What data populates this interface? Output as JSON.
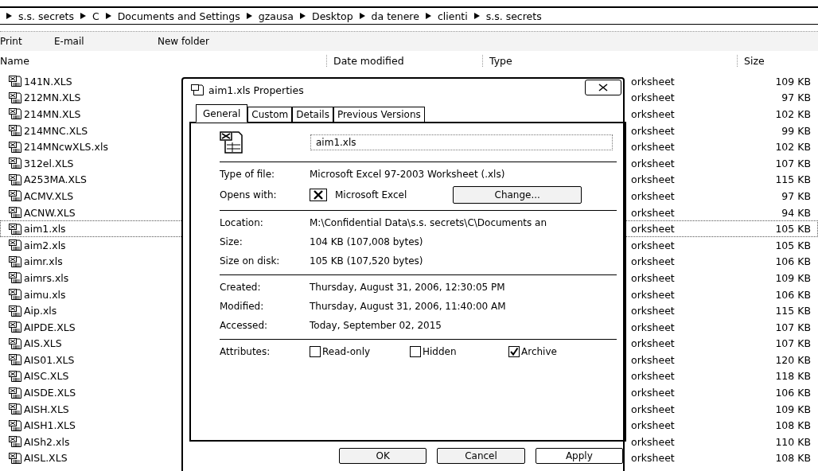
{
  "breadcrumb": [
    "s.s. secrets",
    "C",
    "Documents and Settings",
    "gzausa",
    "Desktop",
    "da tenere",
    "clienti",
    "s.s. secrets"
  ],
  "toolbar": [
    "Print",
    "E-mail",
    "New folder"
  ],
  "columns": [
    "Name",
    "Date modified",
    "Type",
    "Size"
  ],
  "files": [
    {
      "name": "141N.XLS",
      "type": "orksheet",
      "size": "109 KB",
      "selected": false
    },
    {
      "name": "212MN.XLS",
      "type": "orksheet",
      "size": "97 KB",
      "selected": false
    },
    {
      "name": "214MN.XLS",
      "type": "orksheet",
      "size": "102 KB",
      "selected": false
    },
    {
      "name": "214MNC.XLS",
      "type": "orksheet",
      "size": "99 KB",
      "selected": false
    },
    {
      "name": "214MNcwXLS.xls",
      "type": "orksheet",
      "size": "102 KB",
      "selected": false
    },
    {
      "name": "312el.XLS",
      "type": "orksheet",
      "size": "107 KB",
      "selected": false
    },
    {
      "name": "A253MA.XLS",
      "type": "orksheet",
      "size": "115 KB",
      "selected": false
    },
    {
      "name": "ACMV.XLS",
      "type": "orksheet",
      "size": "97 KB",
      "selected": false
    },
    {
      "name": "ACNW.XLS",
      "type": "orksheet",
      "size": "94 KB",
      "selected": false
    },
    {
      "name": "aim1.xls",
      "type": "orksheet",
      "size": "105 KB",
      "selected": true
    },
    {
      "name": "aim2.xls",
      "type": "orksheet",
      "size": "105 KB",
      "selected": false
    },
    {
      "name": "aimr.xls",
      "type": "orksheet",
      "size": "106 KB",
      "selected": false
    },
    {
      "name": "aimrs.xls",
      "type": "orksheet",
      "size": "109 KB",
      "selected": false
    },
    {
      "name": "aimu.xls",
      "type": "orksheet",
      "size": "106 KB",
      "selected": false
    },
    {
      "name": "Aip.xls",
      "type": "orksheet",
      "size": "115 KB",
      "selected": false
    },
    {
      "name": "AIPDE.XLS",
      "type": "orksheet",
      "size": "107 KB",
      "selected": false
    },
    {
      "name": "AIS.XLS",
      "type": "orksheet",
      "size": "107 KB",
      "selected": false
    },
    {
      "name": "AIS01.XLS",
      "type": "orksheet",
      "size": "120 KB",
      "selected": false
    },
    {
      "name": "AISC.XLS",
      "type": "orksheet",
      "size": "118 KB",
      "selected": false
    },
    {
      "name": "AISDE.XLS",
      "type": "orksheet",
      "size": "106 KB",
      "selected": false
    },
    {
      "name": "AISH.XLS",
      "type": "orksheet",
      "size": "109 KB",
      "selected": false
    },
    {
      "name": "AISH1.XLS",
      "type": "orksheet",
      "size": "108 KB",
      "selected": false
    },
    {
      "name": "AISh2.xls",
      "type": "orksheet",
      "size": "110 KB",
      "selected": false
    },
    {
      "name": "AISL.XLS",
      "type": "orksheet",
      "size": "108 KB",
      "selected": false
    }
  ],
  "dialog": {
    "title": "aim1.xls Properties",
    "tabs": [
      {
        "label": "General",
        "selected": true
      },
      {
        "label": "Custom",
        "selected": false
      },
      {
        "label": "Details",
        "selected": false
      },
      {
        "label": "Previous Versions",
        "selected": false
      }
    ],
    "file_name": "aim1.xls",
    "type_of_file": {
      "label": "Type of file:",
      "value": "Microsoft Excel 97-2003 Worksheet (.xls)"
    },
    "opens_with": {
      "label": "Opens with:",
      "value": "Microsoft Excel",
      "button": "Change..."
    },
    "location_group": [
      {
        "label": "Location:",
        "value": "M:\\Confidential Data\\s.s. secrets\\C\\Documents an"
      },
      {
        "label": "Size:",
        "value": "104 KB (107,008 bytes)"
      },
      {
        "label": "Size on disk:",
        "value": "105 KB (107,520 bytes)"
      }
    ],
    "date_group": [
      {
        "label": "Created:",
        "value": "Thursday, August 31, 2006, 12:30:05 PM"
      },
      {
        "label": "Modified:",
        "value": "Thursday, August 31, 2006, 11:40:00 AM"
      },
      {
        "label": "Accessed:",
        "value": "Today, September 02, 2015"
      }
    ],
    "attributes_label": "Attributes:",
    "attributes": [
      {
        "label": "Read-only",
        "checked": false
      },
      {
        "label": "Hidden",
        "checked": false
      },
      {
        "label": "Archive",
        "checked": true
      }
    ],
    "buttons": [
      "OK",
      "Cancel",
      "Apply"
    ]
  }
}
